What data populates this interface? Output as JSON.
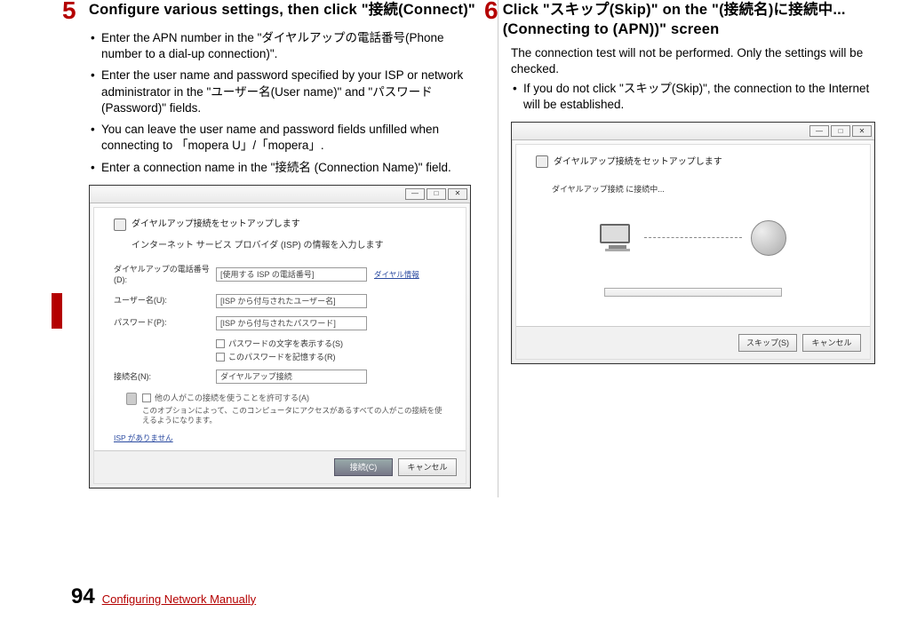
{
  "step5": {
    "number": "5",
    "title": "Configure various settings, then click \"接続(Connect)\"",
    "bullets": [
      " Enter the APN number in the \"ダイヤルアップの電話番号(Phone number to a dial-up connection)\".",
      "Enter the user name and password specified by your ISP or network administrator in the \"ユーザー名(User name)\" and \"パスワード(Password)\" fields.",
      "You can leave the user name and password fields unfilled when connecting to 「mopera U」/「mopera」.",
      "Enter a connection name in the \"接続名 (Connection Name)\" field."
    ],
    "dialog": {
      "title": "ダイヤルアップ接続をセットアップします",
      "isp_line": "インターネット サービス プロバイダ (ISP) の情報を入力します",
      "phone_label": "ダイヤルアップの電話番号(D):",
      "phone_value": "[使用する ISP の電話番号]",
      "phone_link": "ダイヤル情報",
      "user_label": "ユーザー名(U):",
      "user_value": "[ISP から付与されたユーザー名]",
      "pass_label": "パスワード(P):",
      "pass_value": "[ISP から付与されたパスワード]",
      "show_chars": "パスワードの文字を表示する(S)",
      "remember": "このパスワードを記憶する(R)",
      "conn_label": "接続名(N):",
      "conn_value": "ダイヤルアップ接続",
      "allow_others": "他の人がこの接続を使うことを許可する(A)",
      "allow_note": "このオプションによって、このコンピュータにアクセスがあるすべての人がこの接続を使えるようになります。",
      "isp_none": "ISP がありません",
      "btn_connect": "接続(C)",
      "btn_cancel": "キャンセル"
    }
  },
  "step6": {
    "number": "6",
    "title": "Click \"スキップ(Skip)\" on the \"(接続名)に接続中...(Connecting to (APN))\" screen",
    "line1": "The connection test will not be performed. Only the settings will be checked.",
    "bullets": [
      "If you do not click \"スキップ(Skip)\", the connection to the Internet will be established."
    ],
    "dialog": {
      "title": "ダイヤルアップ接続をセットアップします",
      "connecting": "ダイヤルアップ接続 に接続中...",
      "btn_skip": "スキップ(S)",
      "btn_cancel": "キャンセル"
    }
  },
  "footer": {
    "page": "94",
    "text": "Configuring Network Manually"
  }
}
